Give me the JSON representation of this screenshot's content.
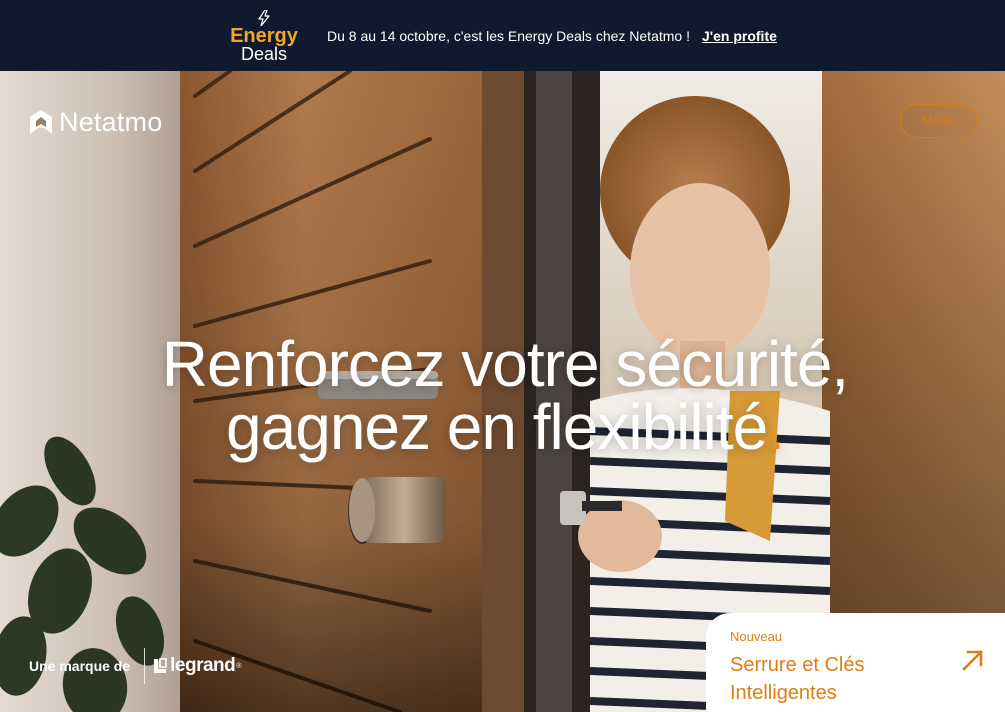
{
  "promo": {
    "logo_line1": "Energy",
    "logo_line2": "Deals",
    "logo_icon": "lightning-bolt-icon",
    "text": "Du 8 au 14 octobre, c'est les Energy Deals chez Netatmo !",
    "link_label": "J'en profite"
  },
  "header": {
    "brand_name": "Netatmo",
    "brand_icon": "netatmo-house-logo-icon",
    "menu_label": "Menu"
  },
  "hero": {
    "headline_line1": "Renforcez votre sécurité,",
    "headline_line2": "gagnez en flexibilité",
    "headline_accent": "."
  },
  "footer_brand": {
    "label": "Une marque de",
    "partner": "legrand",
    "registered": "®"
  },
  "product_card": {
    "tag": "Nouveau",
    "title": "Serrure et Clés Intelligentes",
    "icon": "arrow-up-right-icon"
  },
  "colors": {
    "promo_bg": "#0f1a2e",
    "energy_orange": "#f5a623",
    "accent": "#e07d13",
    "menu_border": "#d97b12"
  }
}
